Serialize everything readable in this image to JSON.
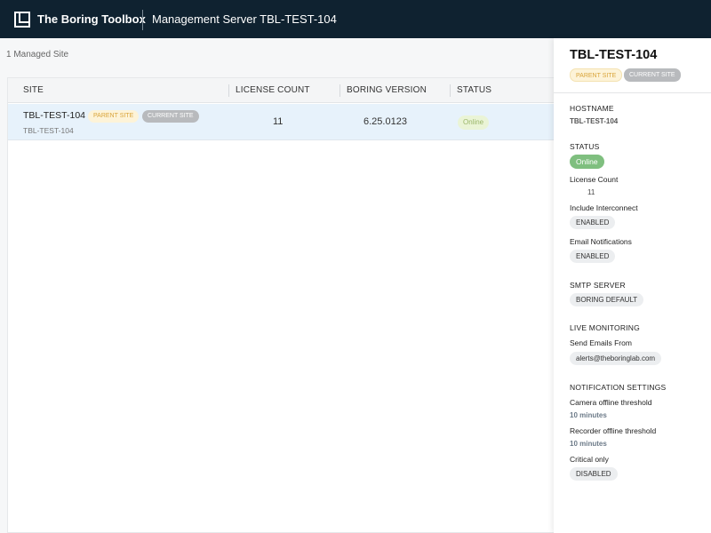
{
  "header": {
    "brand": "The Boring Toolbox",
    "title": "Management Server TBL-TEST-104"
  },
  "main": {
    "site_count": "1 Managed Site",
    "columns": [
      "SITE",
      "LICENSE COUNT",
      "BORING VERSION",
      "STATUS"
    ],
    "rows": [
      {
        "name": "TBL-TEST-104",
        "hostname": "TBL-TEST-104",
        "badge_parent": "PARENT SITE",
        "badge_current": "CURRENT SITE",
        "license_count": "11",
        "version": "6.25.0123",
        "status": "Online"
      }
    ]
  },
  "panel": {
    "title": "TBL-TEST-104",
    "badge_parent": "PARENT SITE",
    "badge_current": "CURRENT SITE",
    "hostname_label": "HOSTNAME",
    "hostname_value": "TBL-TEST-104",
    "status_label": "STATUS",
    "status_value": "Online",
    "license_label": "License Count",
    "license_value": "11",
    "interconnect_label": "Include Interconnect",
    "interconnect_value": "ENABLED",
    "email_notif_label": "Email Notifications",
    "email_notif_value": "ENABLED",
    "smtp_label": "SMTP SERVER",
    "smtp_value": "BORING DEFAULT",
    "live_label": "LIVE MONITORING",
    "send_from_label": "Send Emails From",
    "send_from_value": "alerts@theboringlab.com",
    "notif_settings_label": "NOTIFICATION SETTINGS",
    "camera_label": "Camera offline threshold",
    "camera_value": "10 minutes",
    "recorder_label": "Recorder offline threshold",
    "recorder_value": "10 minutes",
    "critical_label": "Critical only",
    "critical_value": "DISABLED"
  },
  "colors": {
    "topbar": "#0f2230",
    "row_selected": "#e7f2fb",
    "online_green": "#7fbf7f",
    "parent_badge": "#fdf3d8"
  }
}
